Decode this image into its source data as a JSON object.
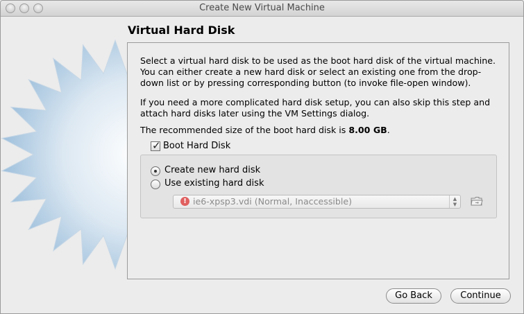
{
  "window": {
    "title": "Create New Virtual Machine"
  },
  "page": {
    "title": "Virtual Hard Disk"
  },
  "description": {
    "para1_lines": [
      "Select a virtual hard disk to be used as the boot hard disk of the virtual machine.",
      "You can either create a new hard disk or select an existing one from the drop-",
      "down list or by pressing corresponding button (to invoke file-open window)."
    ],
    "para2_lines": [
      "If you need a more complicated hard disk setup, you can also skip this step and",
      "attach hard disks later using the VM Settings dialog."
    ],
    "recommended_prefix": "The recommended size of the boot hard disk is ",
    "recommended_size": "8.00 GB",
    "recommended_suffix": "."
  },
  "boot_disk": {
    "label": "Boot Hard Disk",
    "checked": true
  },
  "options": {
    "create_new": {
      "label": "Create new hard disk",
      "selected": true
    },
    "use_existing": {
      "label": "Use existing hard disk",
      "selected": false
    }
  },
  "existing_disk_select": {
    "value": "ie6-xpsp3.vdi (Normal, Inaccessible)",
    "status_icon": "error-icon",
    "enabled": false
  },
  "buttons": {
    "back": "Go Back",
    "continue": "Continue"
  },
  "colors": {
    "window_bg": "#ececec",
    "error_icon": "#e06060",
    "starburst": "#9fc0dc"
  }
}
